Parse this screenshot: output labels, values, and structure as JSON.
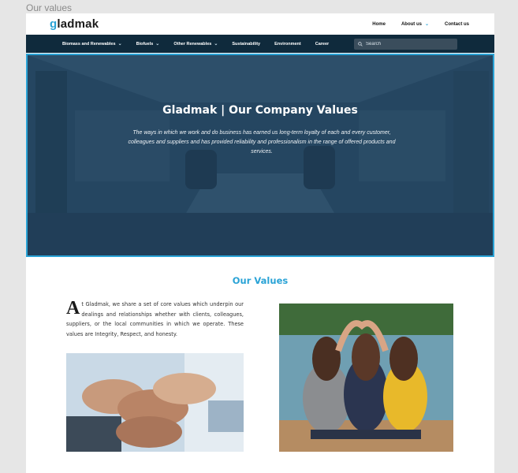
{
  "frame_label": "Our values",
  "header": {
    "logo_first": "g",
    "logo_rest": "ladmak",
    "links": [
      {
        "label": "Home"
      },
      {
        "label": "About us",
        "dropdown": true
      },
      {
        "label": "Contact us"
      }
    ]
  },
  "nav": {
    "items": [
      {
        "label": "Biomass and Renewables",
        "dropdown": true
      },
      {
        "label": "Biofuels",
        "dropdown": true
      },
      {
        "label": "Other Renewables",
        "dropdown": true
      },
      {
        "label": "Sustainability",
        "dropdown": false
      },
      {
        "label": "Environment",
        "dropdown": false
      },
      {
        "label": "Career",
        "dropdown": false
      }
    ],
    "search_placeholder": "Search"
  },
  "hero": {
    "title": "Gladmak | Our Company Values",
    "text": "The ways in which we work and do business has earned us long-term loyalty of each and every customer, colleagues and suppliers and has provided reliability and professionalism in the range of offered products and services."
  },
  "values": {
    "title": "Our Values",
    "dropcap": "A",
    "intro": "t Gladmak, we share a set of core values which underpin our dealings and relationships whether with clients, colleagues, suppliers, or the local communities in which we operate. These values are Integrity, Respect, and honesty."
  },
  "colors": {
    "accent": "#2aa3d6",
    "nav_bg": "#0f2a3c",
    "search_bg": "#3a4d5c"
  },
  "icons": {
    "search": "search-icon",
    "chevron": "chevron-down-icon"
  }
}
